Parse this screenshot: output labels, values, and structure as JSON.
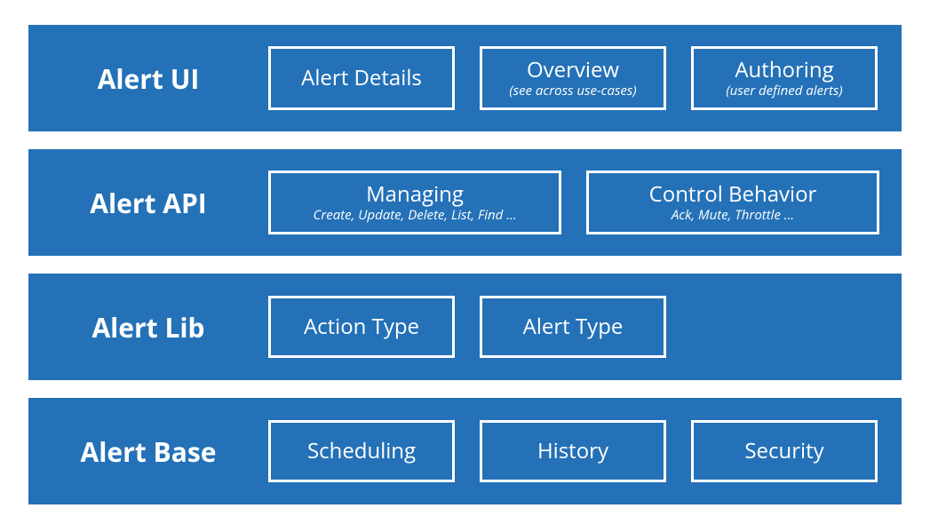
{
  "colors": {
    "band": "#2471b7",
    "outline": "#ffffff",
    "text": "#ffffff"
  },
  "layers": {
    "ui": {
      "label": "Alert UI",
      "items": [
        {
          "title": "Alert Details",
          "sub": ""
        },
        {
          "title": "Overview",
          "sub": "(see across use-cases)"
        },
        {
          "title": "Authoring",
          "sub": "(user defined alerts)"
        }
      ]
    },
    "api": {
      "label": "Alert API",
      "items": [
        {
          "title": "Managing",
          "sub": "Create, Update, Delete, List, Find ..."
        },
        {
          "title": "Control Behavior",
          "sub": "Ack, Mute, Throttle ..."
        }
      ]
    },
    "lib": {
      "label": "Alert Lib",
      "items": [
        {
          "title": "Action Type",
          "sub": ""
        },
        {
          "title": "Alert Type",
          "sub": ""
        }
      ]
    },
    "base": {
      "label": "Alert Base",
      "items": [
        {
          "title": "Scheduling",
          "sub": ""
        },
        {
          "title": "History",
          "sub": ""
        },
        {
          "title": "Security",
          "sub": ""
        }
      ]
    }
  }
}
